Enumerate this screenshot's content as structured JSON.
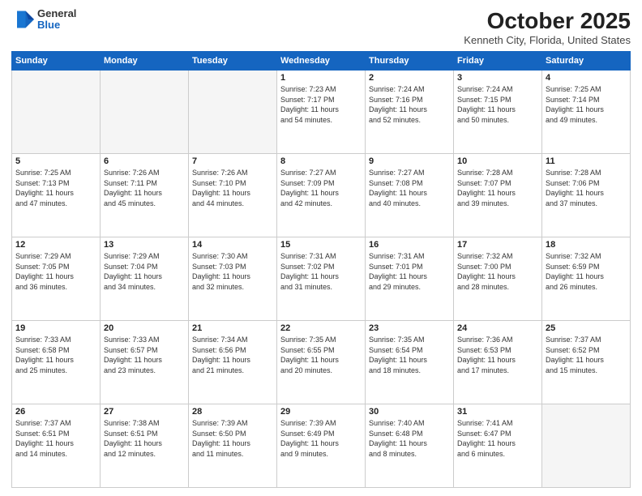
{
  "header": {
    "logo_general": "General",
    "logo_blue": "Blue",
    "month": "October 2025",
    "location": "Kenneth City, Florida, United States"
  },
  "days_of_week": [
    "Sunday",
    "Monday",
    "Tuesday",
    "Wednesday",
    "Thursday",
    "Friday",
    "Saturday"
  ],
  "weeks": [
    [
      {
        "day": "",
        "info": ""
      },
      {
        "day": "",
        "info": ""
      },
      {
        "day": "",
        "info": ""
      },
      {
        "day": "1",
        "info": "Sunrise: 7:23 AM\nSunset: 7:17 PM\nDaylight: 11 hours\nand 54 minutes."
      },
      {
        "day": "2",
        "info": "Sunrise: 7:24 AM\nSunset: 7:16 PM\nDaylight: 11 hours\nand 52 minutes."
      },
      {
        "day": "3",
        "info": "Sunrise: 7:24 AM\nSunset: 7:15 PM\nDaylight: 11 hours\nand 50 minutes."
      },
      {
        "day": "4",
        "info": "Sunrise: 7:25 AM\nSunset: 7:14 PM\nDaylight: 11 hours\nand 49 minutes."
      }
    ],
    [
      {
        "day": "5",
        "info": "Sunrise: 7:25 AM\nSunset: 7:13 PM\nDaylight: 11 hours\nand 47 minutes."
      },
      {
        "day": "6",
        "info": "Sunrise: 7:26 AM\nSunset: 7:11 PM\nDaylight: 11 hours\nand 45 minutes."
      },
      {
        "day": "7",
        "info": "Sunrise: 7:26 AM\nSunset: 7:10 PM\nDaylight: 11 hours\nand 44 minutes."
      },
      {
        "day": "8",
        "info": "Sunrise: 7:27 AM\nSunset: 7:09 PM\nDaylight: 11 hours\nand 42 minutes."
      },
      {
        "day": "9",
        "info": "Sunrise: 7:27 AM\nSunset: 7:08 PM\nDaylight: 11 hours\nand 40 minutes."
      },
      {
        "day": "10",
        "info": "Sunrise: 7:28 AM\nSunset: 7:07 PM\nDaylight: 11 hours\nand 39 minutes."
      },
      {
        "day": "11",
        "info": "Sunrise: 7:28 AM\nSunset: 7:06 PM\nDaylight: 11 hours\nand 37 minutes."
      }
    ],
    [
      {
        "day": "12",
        "info": "Sunrise: 7:29 AM\nSunset: 7:05 PM\nDaylight: 11 hours\nand 36 minutes."
      },
      {
        "day": "13",
        "info": "Sunrise: 7:29 AM\nSunset: 7:04 PM\nDaylight: 11 hours\nand 34 minutes."
      },
      {
        "day": "14",
        "info": "Sunrise: 7:30 AM\nSunset: 7:03 PM\nDaylight: 11 hours\nand 32 minutes."
      },
      {
        "day": "15",
        "info": "Sunrise: 7:31 AM\nSunset: 7:02 PM\nDaylight: 11 hours\nand 31 minutes."
      },
      {
        "day": "16",
        "info": "Sunrise: 7:31 AM\nSunset: 7:01 PM\nDaylight: 11 hours\nand 29 minutes."
      },
      {
        "day": "17",
        "info": "Sunrise: 7:32 AM\nSunset: 7:00 PM\nDaylight: 11 hours\nand 28 minutes."
      },
      {
        "day": "18",
        "info": "Sunrise: 7:32 AM\nSunset: 6:59 PM\nDaylight: 11 hours\nand 26 minutes."
      }
    ],
    [
      {
        "day": "19",
        "info": "Sunrise: 7:33 AM\nSunset: 6:58 PM\nDaylight: 11 hours\nand 25 minutes."
      },
      {
        "day": "20",
        "info": "Sunrise: 7:33 AM\nSunset: 6:57 PM\nDaylight: 11 hours\nand 23 minutes."
      },
      {
        "day": "21",
        "info": "Sunrise: 7:34 AM\nSunset: 6:56 PM\nDaylight: 11 hours\nand 21 minutes."
      },
      {
        "day": "22",
        "info": "Sunrise: 7:35 AM\nSunset: 6:55 PM\nDaylight: 11 hours\nand 20 minutes."
      },
      {
        "day": "23",
        "info": "Sunrise: 7:35 AM\nSunset: 6:54 PM\nDaylight: 11 hours\nand 18 minutes."
      },
      {
        "day": "24",
        "info": "Sunrise: 7:36 AM\nSunset: 6:53 PM\nDaylight: 11 hours\nand 17 minutes."
      },
      {
        "day": "25",
        "info": "Sunrise: 7:37 AM\nSunset: 6:52 PM\nDaylight: 11 hours\nand 15 minutes."
      }
    ],
    [
      {
        "day": "26",
        "info": "Sunrise: 7:37 AM\nSunset: 6:51 PM\nDaylight: 11 hours\nand 14 minutes."
      },
      {
        "day": "27",
        "info": "Sunrise: 7:38 AM\nSunset: 6:51 PM\nDaylight: 11 hours\nand 12 minutes."
      },
      {
        "day": "28",
        "info": "Sunrise: 7:39 AM\nSunset: 6:50 PM\nDaylight: 11 hours\nand 11 minutes."
      },
      {
        "day": "29",
        "info": "Sunrise: 7:39 AM\nSunset: 6:49 PM\nDaylight: 11 hours\nand 9 minutes."
      },
      {
        "day": "30",
        "info": "Sunrise: 7:40 AM\nSunset: 6:48 PM\nDaylight: 11 hours\nand 8 minutes."
      },
      {
        "day": "31",
        "info": "Sunrise: 7:41 AM\nSunset: 6:47 PM\nDaylight: 11 hours\nand 6 minutes."
      },
      {
        "day": "",
        "info": ""
      }
    ]
  ]
}
